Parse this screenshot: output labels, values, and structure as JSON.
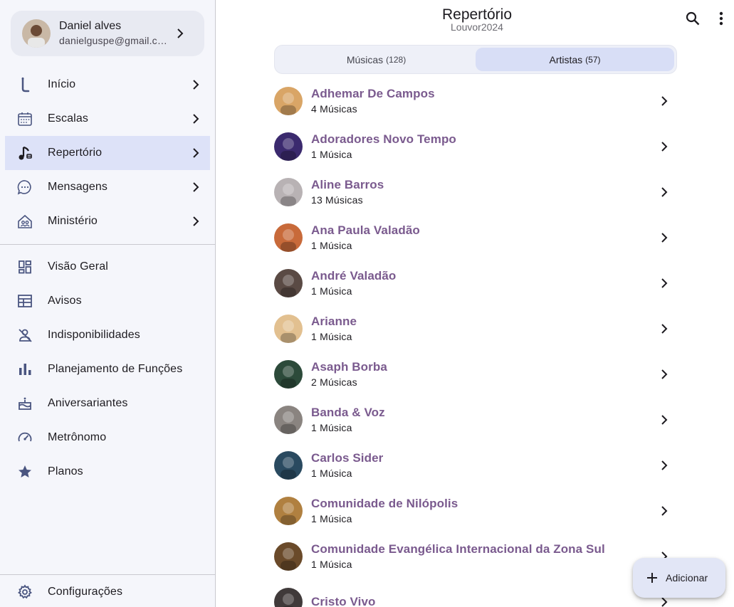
{
  "colors": {
    "accent": "#7a5a8e",
    "active_bg": "#dde2f8",
    "sidebar_bg": "#f5f6fb",
    "icon": "#4a5580"
  },
  "profile": {
    "name": "Daniel alves",
    "email": "danielguspe@gmail.com"
  },
  "sidebar": {
    "main_items": [
      {
        "label": "Início",
        "icon": "guitar-icon"
      },
      {
        "label": "Escalas",
        "icon": "calendar-icon"
      },
      {
        "label": "Repertório",
        "icon": "music-note-icon"
      },
      {
        "label": "Mensagens",
        "icon": "chat-bubble-icon"
      },
      {
        "label": "Ministério",
        "icon": "church-icon"
      }
    ],
    "secondary_items": [
      {
        "label": "Visão Geral",
        "icon": "dashboard-icon"
      },
      {
        "label": "Avisos",
        "icon": "notice-board-icon"
      },
      {
        "label": "Indisponibilidades",
        "icon": "person-off-icon"
      },
      {
        "label": "Planejamento de Funções",
        "icon": "bar-chart-icon"
      },
      {
        "label": "Aniversariantes",
        "icon": "cake-icon"
      },
      {
        "label": "Metrônomo",
        "icon": "speedometer-icon"
      },
      {
        "label": "Planos",
        "icon": "star-icon"
      }
    ],
    "settings_label": "Configurações"
  },
  "header": {
    "title": "Repertório",
    "subtitle": "Louvor2024"
  },
  "tabs": [
    {
      "label": "Músicas",
      "count": "(128)",
      "active": false
    },
    {
      "label": "Artistas",
      "count": "(57)",
      "active": true
    }
  ],
  "artists": [
    {
      "name": "Adhemar De Campos",
      "count": "4 Músicas",
      "color": "#d9a566"
    },
    {
      "name": "Adoradores Novo Tempo",
      "count": "1 Música",
      "color": "#3b2a6e"
    },
    {
      "name": "Aline Barros",
      "count": "13 Músicas",
      "color": "#b8b2b4"
    },
    {
      "name": "Ana Paula Valadão",
      "count": "1 Música",
      "color": "#c86a3a"
    },
    {
      "name": "André Valadão",
      "count": "1 Música",
      "color": "#5a4a44"
    },
    {
      "name": "Arianne",
      "count": "1 Música",
      "color": "#e2c090"
    },
    {
      "name": "Asaph Borba",
      "count": "2 Músicas",
      "color": "#2c4a3a"
    },
    {
      "name": "Banda & Voz",
      "count": "1 Música",
      "color": "#8a8480"
    },
    {
      "name": "Carlos Sider",
      "count": "1 Música",
      "color": "#2a4a60"
    },
    {
      "name": "Comunidade de Nilópolis",
      "count": "1 Música",
      "color": "#b08040"
    },
    {
      "name": "Comunidade Evangélica Internacional da Zona Sul",
      "count": "1 Música",
      "color": "#6a4a2a"
    },
    {
      "name": "Cristo Vivo",
      "count": "",
      "color": "#403a3a"
    }
  ],
  "fab": {
    "label": "Adicionar"
  }
}
